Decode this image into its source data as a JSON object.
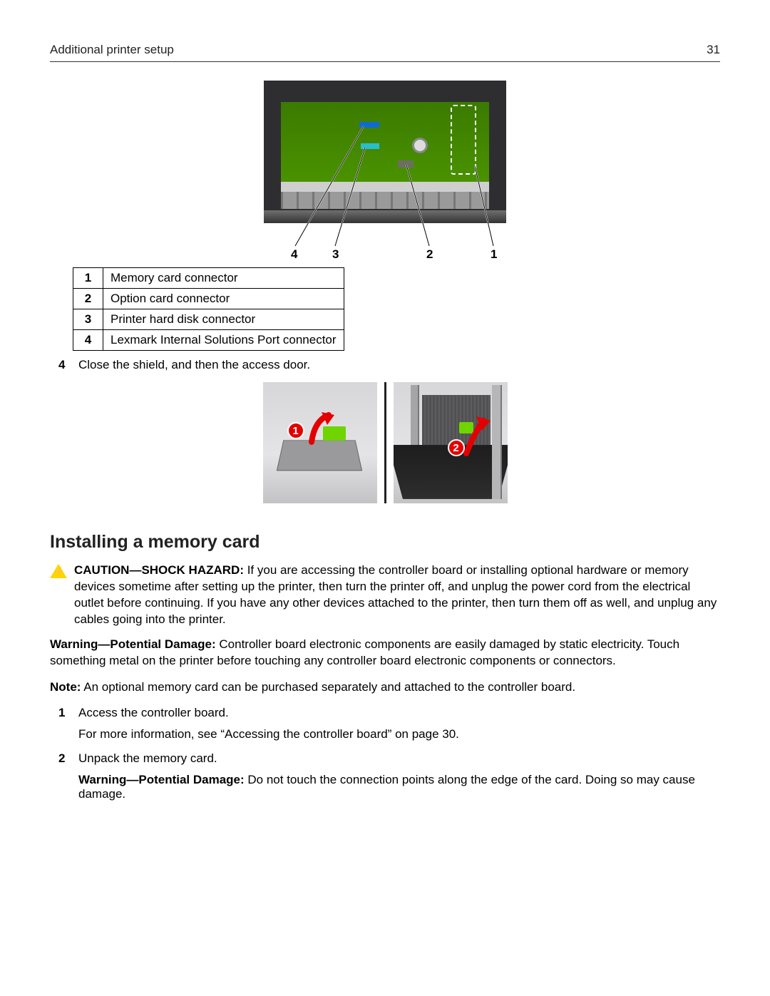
{
  "header": {
    "title": "Additional printer setup",
    "page": "31"
  },
  "diagram1": {
    "labels": {
      "l1": "1",
      "l2": "2",
      "l3": "3",
      "l4": "4"
    }
  },
  "legend": [
    {
      "n": "1",
      "t": "Memory card connector"
    },
    {
      "n": "2",
      "t": "Option card connector"
    },
    {
      "n": "3",
      "t": "Printer hard disk connector"
    },
    {
      "n": "4",
      "t": "Lexmark Internal Solutions Port connector"
    }
  ],
  "step4": {
    "n": "4",
    "t": "Close the shield, and then the access door."
  },
  "badges": {
    "a": "1",
    "b": "2"
  },
  "section_heading": "Installing a memory card",
  "caution": {
    "lead": "CAUTION—SHOCK HAZARD:",
    "body": " If you are accessing the controller board or installing optional hardware or memory devices sometime after setting up the printer, then turn the printer off, and unplug the power cord from the electrical outlet before continuing. If you have any other devices attached to the printer, then turn them off as well, and unplug any cables going into the printer."
  },
  "warning1": {
    "lead": "Warning—Potential Damage:",
    "body": " Controller board electronic components are easily damaged by static electricity. Touch something metal on the printer before touching any controller board electronic components or connectors."
  },
  "note": {
    "lead": "Note:",
    "body": " An optional memory card can be purchased separately and attached to the controller board."
  },
  "steps": [
    {
      "n": "1",
      "t": "Access the controller board.",
      "sub": "For more information, see “Accessing the controller board” on page 30."
    },
    {
      "n": "2",
      "t": "Unpack the memory card.",
      "sub_lead": "Warning—Potential Damage:",
      "sub_body": " Do not touch the connection points along the edge of the card. Doing so may cause damage."
    }
  ]
}
